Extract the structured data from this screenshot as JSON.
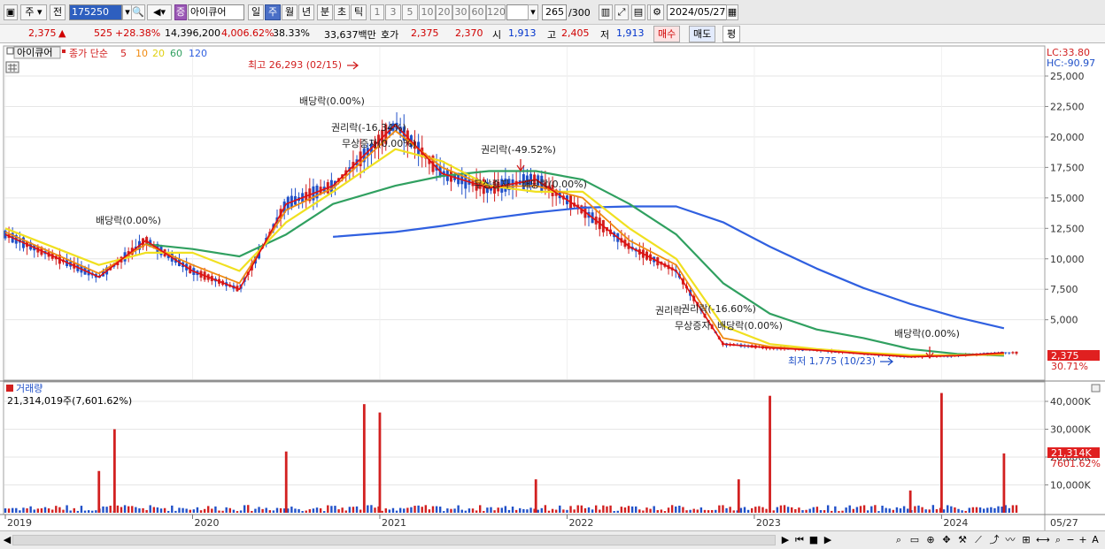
{
  "toolbar": {
    "market_sel": "주",
    "prev_label": "전",
    "code_value": "175250",
    "stock_badge": "증",
    "stock_name": "아이큐어",
    "periods": [
      "일",
      "주",
      "월",
      "년",
      "분",
      "초",
      "틱"
    ],
    "active_period": "주",
    "minute_nums": [
      "1",
      "3",
      "5",
      "10",
      "20",
      "30",
      "60",
      "120"
    ],
    "count_value": "265",
    "count_total": "/300",
    "date_value": "2024/05/27"
  },
  "quote": {
    "price": "2,375",
    "arrow": "▲",
    "change": "525",
    "change_pct": "+28.38%",
    "volume": "14,396,200",
    "volume_pct": "4,006.62%",
    "turnover": "38.33%",
    "amount": "33,637백만",
    "hoga_label": "호가",
    "ask": "2,375",
    "bid": "2,370",
    "open_label": "시",
    "open": "1,913",
    "high_label": "고",
    "high": "2,405",
    "low_label": "저",
    "low": "1,913",
    "buy_label": "매수",
    "sell_label": "매도",
    "eval_label": "평"
  },
  "price_panel": {
    "name_tag": "아이큐어",
    "ma_prefix": "종가 단순",
    "ma_periods": [
      "5",
      "10",
      "20",
      "60",
      "120"
    ],
    "lc": "LC:33.80",
    "hc": "HC:-90.97",
    "last_price_tag": "2,375",
    "last_pct_tag": "30.71%",
    "high_note": "최고 26,293 (02/15)",
    "low_note": "최저 1,775 (10/23)",
    "events": [
      "배당락(0.00%)",
      "배당락(0.00%)",
      "권리락(-16.34%)",
      "무상증자(0.00%)",
      "권리락(-49.52%)",
      "무상증자",
      "배당락(0.00%)",
      "권리락",
      "권리락(-16.60%)",
      "무상증자",
      "배당락(0.00%)",
      "배당락(0.00%)"
    ]
  },
  "volume_panel": {
    "title": "거래량",
    "summary": "21,314,019주(7,601.62%)",
    "last_tag": "21,314K",
    "last_pct": "7601.62%"
  },
  "x_axis_labels": [
    "2019",
    "2020",
    "2021",
    "2022",
    "2023",
    "2024",
    "05/27"
  ],
  "colors": {
    "up": "#d22020",
    "down": "#2050c8",
    "ma5": "#e01010",
    "ma10": "#f08a10",
    "ma20": "#f0e020",
    "ma60": "#30a060",
    "ma120": "#3060e0"
  },
  "chart_data": [
    {
      "type": "line",
      "title": "",
      "y_ticks": [
        "25,000",
        "22,500",
        "20,000",
        "17,500",
        "15,000",
        "12,500",
        "10,000",
        "7,500",
        "5,000"
      ],
      "ylim": [
        0,
        26500
      ],
      "x": [
        "2019-01",
        "2019-07",
        "2019-10",
        "2020-01",
        "2020-04",
        "2020-07",
        "2020-10",
        "2021-02",
        "2021-05",
        "2021-08",
        "2021-11",
        "2022-02",
        "2022-05",
        "2022-08",
        "2022-11",
        "2023-02",
        "2023-05",
        "2023-08",
        "2023-11",
        "2024-02",
        "2024-05"
      ],
      "series": [
        {
          "name": "5",
          "values": [
            12000,
            8500,
            11500,
            9000,
            7500,
            14500,
            16000,
            21000,
            17000,
            15800,
            16500,
            14000,
            11000,
            9000,
            3000,
            2700,
            2500,
            2200,
            1950,
            2050,
            2300
          ]
        },
        {
          "name": "10",
          "values": [
            12200,
            8800,
            11200,
            9500,
            8000,
            14000,
            15800,
            20500,
            17500,
            15900,
            16000,
            15000,
            11500,
            9500,
            3500,
            2800,
            2500,
            2250,
            2000,
            2050,
            2200
          ]
        },
        {
          "name": "20",
          "values": [
            12500,
            9500,
            10500,
            10500,
            9000,
            13000,
            15500,
            19000,
            18000,
            16000,
            15500,
            15500,
            12500,
            10000,
            4500,
            3000,
            2600,
            2300,
            2100,
            2100,
            2150
          ]
        },
        {
          "name": "60",
          "values": [
            null,
            null,
            11200,
            10800,
            10200,
            12000,
            14500,
            16000,
            16800,
            17200,
            17200,
            16500,
            14500,
            12000,
            8000,
            5500,
            4200,
            3500,
            2600,
            2200,
            2050
          ]
        },
        {
          "name": "120",
          "values": [
            null,
            null,
            null,
            null,
            null,
            null,
            11800,
            12200,
            12700,
            13300,
            13800,
            14200,
            14300,
            14300,
            13000,
            11000,
            9200,
            7600,
            6300,
            5200,
            4300
          ]
        }
      ]
    },
    {
      "type": "bar",
      "title": "거래량",
      "y_ticks": [
        "40,000K",
        "30,000K",
        "20,000K",
        "10,000K"
      ],
      "ylim": [
        0,
        45000
      ],
      "spikes": [
        {
          "x": "2019-07",
          "value": 15000
        },
        {
          "x": "2019-08",
          "value": 30000
        },
        {
          "x": "2020-07",
          "value": 22000
        },
        {
          "x": "2020-12",
          "value": 39000
        },
        {
          "x": "2021-01",
          "value": 36000
        },
        {
          "x": "2021-11",
          "value": 12000
        },
        {
          "x": "2022-12",
          "value": 12000
        },
        {
          "x": "2023-02",
          "value": 42000
        },
        {
          "x": "2023-11",
          "value": 8000
        },
        {
          "x": "2024-01",
          "value": 43000
        },
        {
          "x": "2024-05",
          "value": 21314
        }
      ]
    }
  ]
}
